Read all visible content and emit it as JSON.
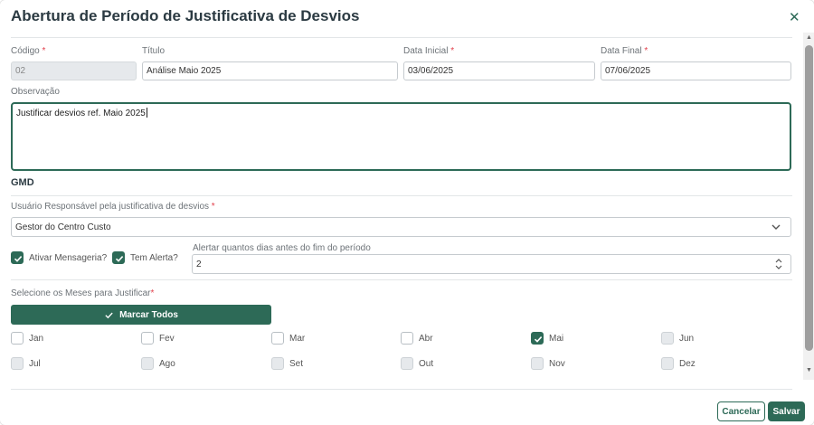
{
  "modal": {
    "title": "Abertura de Período de Justificativa de Desvios",
    "close_icon": "close-icon"
  },
  "form": {
    "codigo": {
      "label": "Código",
      "value": "02"
    },
    "titulo": {
      "label": "Título",
      "value": "Análise Maio 2025"
    },
    "data_inicial": {
      "label": "Data Inicial",
      "value": "03/06/2025"
    },
    "data_final": {
      "label": "Data Final",
      "value": "07/06/2025"
    },
    "observacao": {
      "label": "Observação",
      "value": "Justificar desvios ref. Maio 2025"
    }
  },
  "gmd": {
    "section_title": "GMD",
    "usuario_label": "Usuário Responsável pela justificativa de desvios",
    "usuario_value": "Gestor do Centro Custo",
    "ativar_mensageria": {
      "label": "Ativar Mensageria?",
      "checked": true
    },
    "tem_alerta": {
      "label": "Tem Alerta?",
      "checked": true
    },
    "alertar_label": "Alertar quantos dias antes do fim do período",
    "alertar_value": "2"
  },
  "meses": {
    "label": "Selecione os Meses para Justificar",
    "marcar_todos": "Marcar Todos",
    "items": [
      {
        "label": "Jan",
        "state": "empty"
      },
      {
        "label": "Fev",
        "state": "empty"
      },
      {
        "label": "Mar",
        "state": "empty"
      },
      {
        "label": "Abr",
        "state": "empty"
      },
      {
        "label": "Mai",
        "state": "checked"
      },
      {
        "label": "Jun",
        "state": "disabled"
      },
      {
        "label": "Jul",
        "state": "disabled"
      },
      {
        "label": "Ago",
        "state": "disabled"
      },
      {
        "label": "Set",
        "state": "disabled"
      },
      {
        "label": "Out",
        "state": "disabled"
      },
      {
        "label": "Nov",
        "state": "disabled"
      },
      {
        "label": "Dez",
        "state": "disabled"
      }
    ]
  },
  "footer": {
    "cancel": "Cancelar",
    "save": "Salvar"
  },
  "colors": {
    "accent": "#2d6a57",
    "required": "#e2404c"
  }
}
